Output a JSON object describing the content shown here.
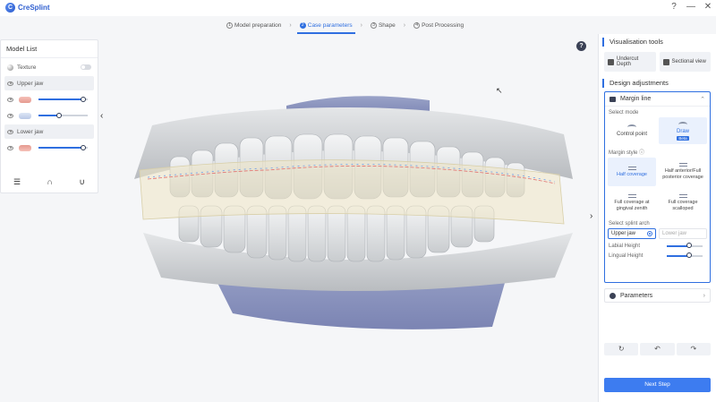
{
  "app": {
    "title": "CreSplint"
  },
  "window": {
    "help": "?",
    "minimize": "—",
    "close": "✕"
  },
  "steps": [
    {
      "num": "1",
      "label": "Model preparation",
      "active": false
    },
    {
      "num": "2",
      "label": "Case parameters",
      "active": true
    },
    {
      "num": "3",
      "label": "Shape",
      "active": false
    },
    {
      "num": "4",
      "label": "Post Processing",
      "active": false
    }
  ],
  "step_separator": "›",
  "model_list": {
    "title": "Model List",
    "texture_label": "Texture",
    "upper_jaw_label": "Upper jaw",
    "lower_jaw_label": "Lower jaw",
    "sliders": {
      "upper1": 0.9,
      "upper2": 0.42,
      "lower1": 0.9
    }
  },
  "visualisation": {
    "title": "Visualisation tools",
    "undercut_label": "Undercut Depth",
    "sectional_label": "Sectional view"
  },
  "design": {
    "title": "Design adjustments",
    "margin_line": "Margin line",
    "select_mode": "Select mode",
    "modes": [
      {
        "label": "Control point",
        "selected": false
      },
      {
        "label": "Draw",
        "selected": true,
        "badge": "Beta"
      }
    ],
    "margin_style": "Margin style",
    "styles": [
      {
        "label": "Half coverage",
        "selected": true
      },
      {
        "label": "Half anterior/Full posterior coverage",
        "selected": false
      },
      {
        "label": "Full coverage at gingival zenith",
        "selected": false
      },
      {
        "label": "Full coverage scalloped",
        "selected": false
      }
    ],
    "select_arch": "Select splint arch",
    "upper_jaw": "Upper jaw",
    "lower_jaw": "Lower jaw",
    "labial_height": "Labial Height",
    "lingual_height": "Lingual Height",
    "labial_value": 0.62,
    "lingual_value": 0.62,
    "parameters": "Parameters"
  },
  "tools": {
    "reset": "↻",
    "undo": "↶",
    "redo": "↷"
  },
  "next_step": "Next Step",
  "colors": {
    "accent": "#2f6fe0",
    "button": "#3d7cf0"
  }
}
